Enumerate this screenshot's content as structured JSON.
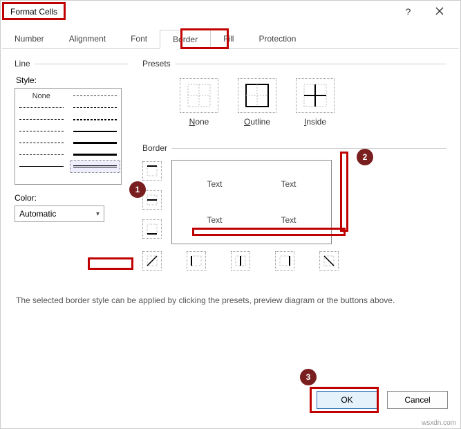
{
  "title": "Format Cells",
  "titlebar": {
    "help": "?",
    "close": "✕"
  },
  "tabs": [
    "Number",
    "Alignment",
    "Font",
    "Border",
    "Fill",
    "Protection"
  ],
  "active_tab_index": 3,
  "line": {
    "group_label": "Line",
    "style_label": "Style:",
    "none_label": "None",
    "color_label": "Color:",
    "color_value": "Automatic"
  },
  "presets": {
    "group_label": "Presets",
    "items": [
      {
        "label": "None",
        "accel": "N"
      },
      {
        "label": "Outline",
        "accel": "O"
      },
      {
        "label": "Inside",
        "accel": "I"
      }
    ]
  },
  "border": {
    "group_label": "Border",
    "preview_cells": [
      "Text",
      "Text",
      "Text",
      "Text"
    ]
  },
  "hint": "The selected border style can be applied by clicking the presets, preview diagram or the buttons above.",
  "buttons": {
    "ok": "OK",
    "cancel": "Cancel"
  },
  "badges": {
    "b1": "1",
    "b2": "2",
    "b3": "3"
  },
  "watermark": "wsxdn.com"
}
